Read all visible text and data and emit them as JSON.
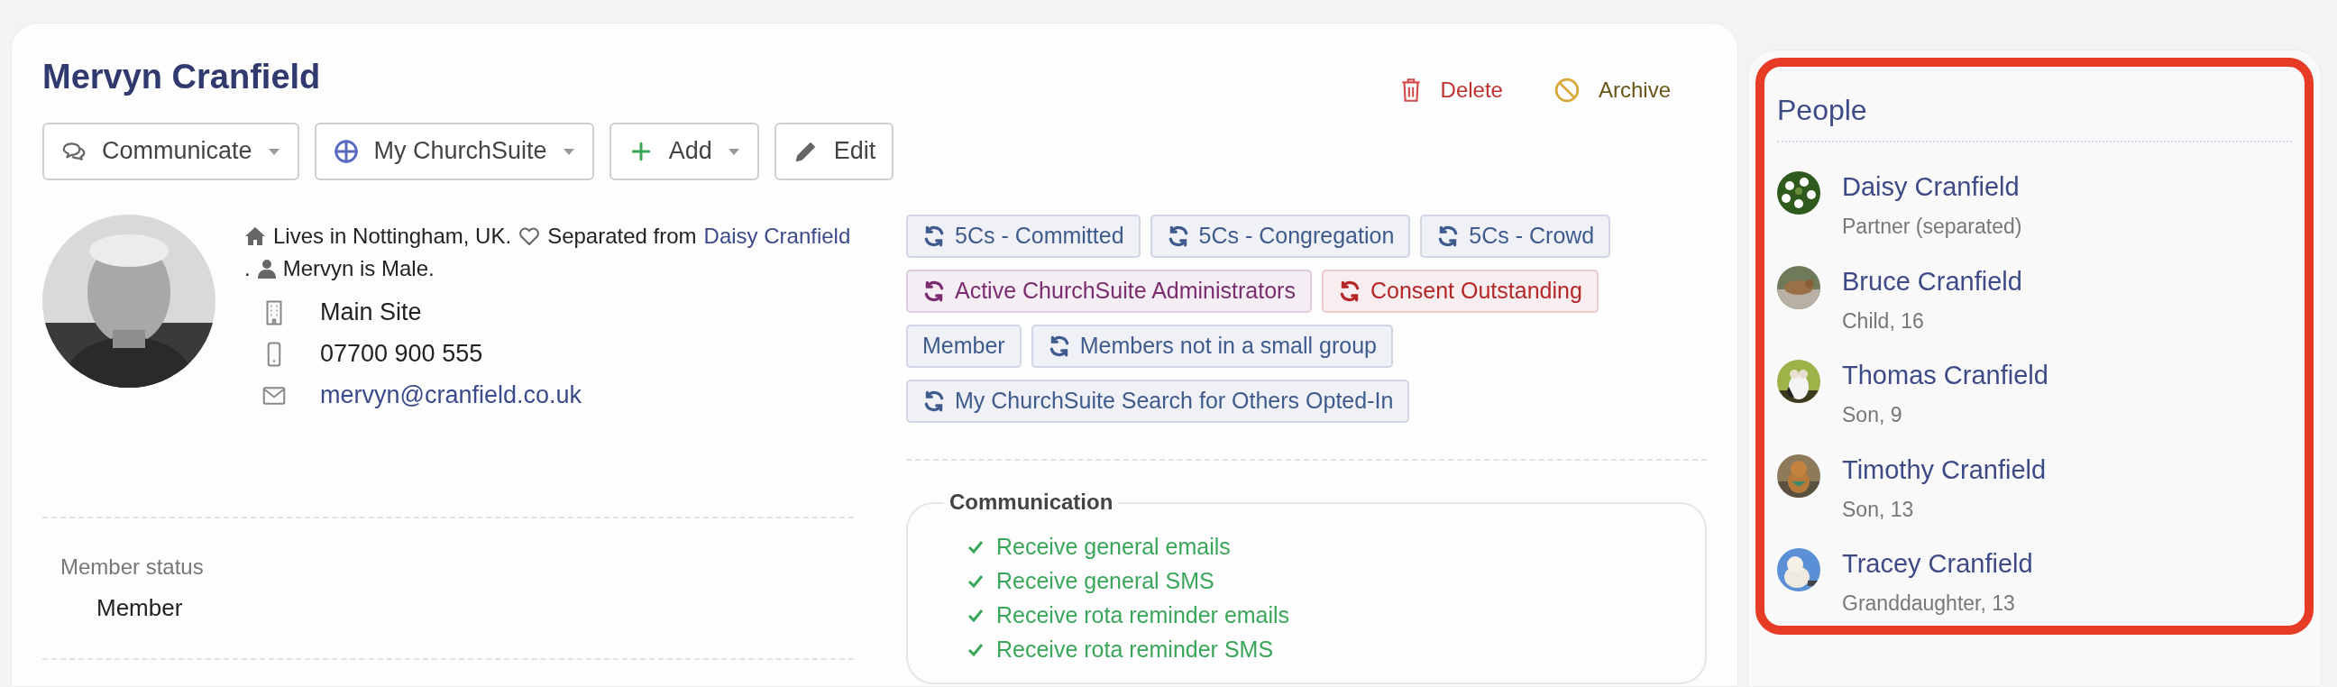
{
  "profile": {
    "name": "Mervyn Cranfield"
  },
  "toolbar": [
    {
      "label": "Communicate",
      "kind": "chat",
      "dropdown": true
    },
    {
      "label": "My ChurchSuite",
      "kind": "globe",
      "dropdown": true
    },
    {
      "label": "Add",
      "kind": "plus",
      "dropdown": true
    },
    {
      "label": "Edit",
      "kind": "pencil",
      "dropdown": false
    }
  ],
  "header_actions": [
    {
      "label": "Delete",
      "kind": "delete"
    },
    {
      "label": "Archive",
      "kind": "archive"
    }
  ],
  "summary": {
    "location": "Lives in Nottingham, UK.",
    "relation_prefix": "Separated from",
    "relation_link": "Daisy Cranfield",
    "relation_suffix": ".",
    "gender": "Mervyn is Male."
  },
  "contacts": [
    {
      "kind": "site",
      "value": "Main Site"
    },
    {
      "kind": "phone",
      "value": "07700 900 555"
    },
    {
      "kind": "email",
      "value": "mervyn@cranfield.co.uk"
    }
  ],
  "tags": [
    {
      "label": "5Cs - Committed",
      "smart": true,
      "color": "#3f5a8c"
    },
    {
      "label": "5Cs - Congregation",
      "smart": true,
      "color": "#3f5a8c"
    },
    {
      "label": "5Cs - Crowd",
      "smart": true,
      "color": "#3f5a8c"
    },
    {
      "label": "Active ChurchSuite Administrators",
      "smart": true,
      "color": "#7b2c6e"
    },
    {
      "label": "Consent Outstanding",
      "smart": true,
      "color": "#b52727"
    },
    {
      "label": "Member",
      "smart": false,
      "color": "#3f5a8c"
    },
    {
      "label": "Members not in a small group",
      "smart": true,
      "color": "#3f5a8c"
    },
    {
      "label": "My ChurchSuite Search for Others Opted-In",
      "smart": true,
      "color": "#3f5a8c"
    }
  ],
  "member_status": {
    "label": "Member status",
    "value": "Member"
  },
  "communication": {
    "title": "Communication",
    "items": [
      {
        "label": "Receive general emails",
        "checked": true
      },
      {
        "label": "Receive general SMS",
        "checked": true
      },
      {
        "label": "Receive rota reminder emails",
        "checked": true
      },
      {
        "label": "Receive rota reminder SMS",
        "checked": true
      }
    ]
  },
  "people": {
    "title": "People",
    "items": [
      {
        "name": "Daisy Cranfield",
        "relation": "Partner (separated)"
      },
      {
        "name": "Bruce Cranfield",
        "relation": "Child, 16"
      },
      {
        "name": "Thomas Cranfield",
        "relation": "Son, 9"
      },
      {
        "name": "Timothy Cranfield",
        "relation": "Son, 13"
      },
      {
        "name": "Tracey Cranfield",
        "relation": "Granddaughter, 13"
      }
    ]
  }
}
